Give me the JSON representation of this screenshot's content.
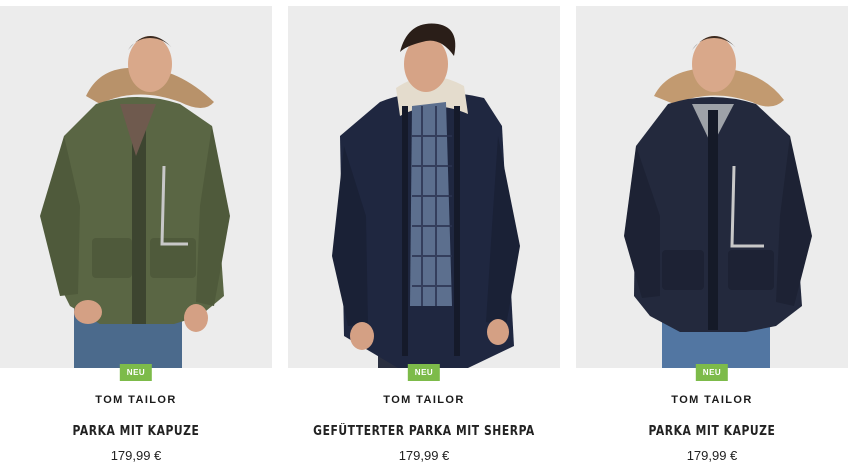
{
  "products": [
    {
      "badge": "NEU",
      "brand": "TOM TAILOR",
      "name": "PARKA MIT KAPUZE",
      "price": "179,99 €",
      "color": "#5a6644"
    },
    {
      "badge": "NEU",
      "brand": "TOM TAILOR",
      "name": "GEFÜTTERTER PARKA MIT SHERPA",
      "price": "179,99 €",
      "color": "#1f2740"
    },
    {
      "badge": "NEU",
      "brand": "TOM TAILOR",
      "name": "PARKA MIT KAPUZE",
      "price": "179,99 €",
      "color": "#23293d"
    }
  ]
}
